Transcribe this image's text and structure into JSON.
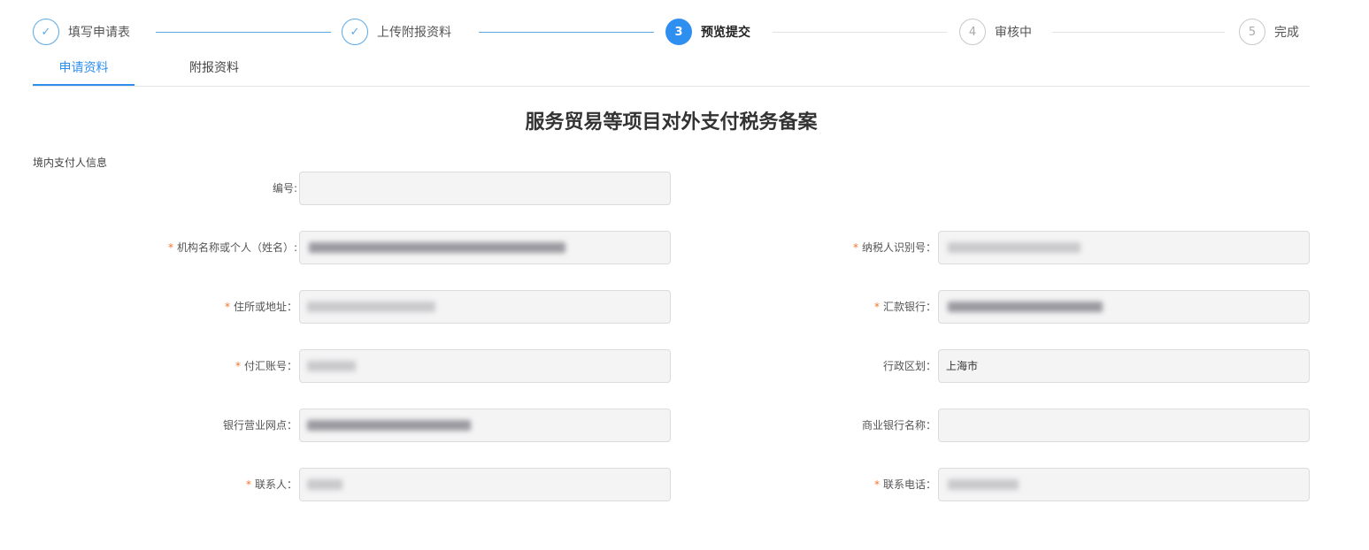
{
  "steps": [
    {
      "number": "✓",
      "label": "填写申请表",
      "status": "done"
    },
    {
      "number": "✓",
      "label": "上传附报资料",
      "status": "done"
    },
    {
      "number": "3",
      "label": "预览提交",
      "status": "active"
    },
    {
      "number": "4",
      "label": "审核中",
      "status": "todo"
    },
    {
      "number": "5",
      "label": "完成",
      "status": "todo"
    }
  ],
  "tabs": [
    {
      "label": "申请资料",
      "active": true
    },
    {
      "label": "附报资料",
      "active": false
    }
  ],
  "form": {
    "title": "服务贸易等项目对外支付税务备案",
    "section": "境内支付人信息",
    "fields": {
      "bianhao": {
        "label": "编号:",
        "required": false,
        "value": ""
      },
      "jigou": {
        "label": "机构名称或个人（姓名）:",
        "required": true,
        "value": ""
      },
      "nashui": {
        "label": "纳税人识别号：",
        "required": true,
        "value": ""
      },
      "zhusuo": {
        "label": "住所或地址：",
        "required": true,
        "value": ""
      },
      "huikuan": {
        "label": "汇款银行：",
        "required": true,
        "value": ""
      },
      "fuhui": {
        "label": "付汇账号：",
        "required": true,
        "value": ""
      },
      "xingzheng": {
        "label": "行政区划：",
        "required": false,
        "value": "上海市"
      },
      "wangdian": {
        "label": "银行营业网点：",
        "required": false,
        "value": ""
      },
      "shangye": {
        "label": "商业银行名称：",
        "required": false,
        "value": ""
      },
      "lianxiren": {
        "label": "联系人：",
        "required": true,
        "value": ""
      },
      "dianhua": {
        "label": "联系电话：",
        "required": true,
        "value": ""
      }
    },
    "required_mark": "*"
  },
  "colors": {
    "accent": "#2e8ff0",
    "required": "#f0762c"
  }
}
